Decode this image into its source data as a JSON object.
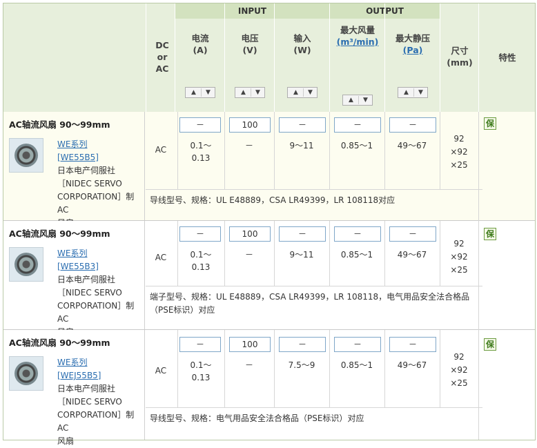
{
  "header": {
    "dc_or_ac": [
      "DC",
      "or",
      "AC"
    ],
    "group_input": "INPUT",
    "group_output": "OUTPUT",
    "columns": [
      {
        "title": "电流",
        "unit": "(A)"
      },
      {
        "title": "电压",
        "unit": "(V)"
      },
      {
        "title": "输入",
        "unit": "(W)"
      },
      {
        "title": "最大风量",
        "unit": "(m³/min)"
      },
      {
        "title": "最大静压",
        "unit": "(Pa)"
      }
    ],
    "size_title": "尺寸",
    "size_unit": "(mm)",
    "feature_title": "特性",
    "sort_up_glyph": "▲",
    "sort_down_glyph": "▼"
  },
  "rows": [
    {
      "title": "AC轴流风扇  90～99mm",
      "series_link": "WE系列",
      "model_link": "[WE55B5]",
      "maker_lines": [
        "日本电产伺服社",
        "［NIDEC SERVO",
        "CORPORATION］制AC",
        "风扇"
      ],
      "dc_ac": "AC",
      "filters": [
        "－",
        "100",
        "－",
        "－",
        "－"
      ],
      "current": [
        "0.1～",
        "0.13"
      ],
      "voltage": "－",
      "input_w": "9～11",
      "airflow": "0.85～1",
      "pressure": "49～67",
      "size": [
        "92",
        "×92",
        "×25"
      ],
      "feature": "保",
      "note": "导线型号、规格：UL  E48889，CSA LR49399，LR 108118对应"
    },
    {
      "title": "AC轴流风扇  90～99mm",
      "series_link": "WE系列",
      "model_link": "[WE55B3]",
      "maker_lines": [
        "日本电产伺服社",
        "［NIDEC SERVO",
        "CORPORATION］制AC",
        "风扇"
      ],
      "dc_ac": "AC",
      "filters": [
        "－",
        "100",
        "－",
        "－",
        "－"
      ],
      "current": [
        "0.1～",
        "0.13"
      ],
      "voltage": "－",
      "input_w": "9～11",
      "airflow": "0.85～1",
      "pressure": "49～67",
      "size": [
        "92",
        "×92",
        "×25"
      ],
      "feature": "保",
      "note": "端子型号、规格：UL  E48889，CSA LR49399，LR 108118，电气用品安全法合格品（PSE标识）对应"
    },
    {
      "title": "AC轴流风扇  90～99mm",
      "series_link": "WE系列",
      "model_link": "[WEJ55B5]",
      "maker_lines": [
        "日本电产伺服社",
        "［NIDEC SERVO",
        "CORPORATION］制AC",
        "风扇"
      ],
      "dc_ac": "AC",
      "filters": [
        "－",
        "100",
        "－",
        "－",
        "－"
      ],
      "current": [
        "0.1～",
        "0.13"
      ],
      "voltage": "－",
      "input_w": "7.5～9",
      "airflow": "0.85～1",
      "pressure": "49～67",
      "size": [
        "92",
        "×92",
        "×25"
      ],
      "feature": "保",
      "note": "导线型号、规格：电气用品安全法合格品（PSE标识）对应"
    }
  ]
}
